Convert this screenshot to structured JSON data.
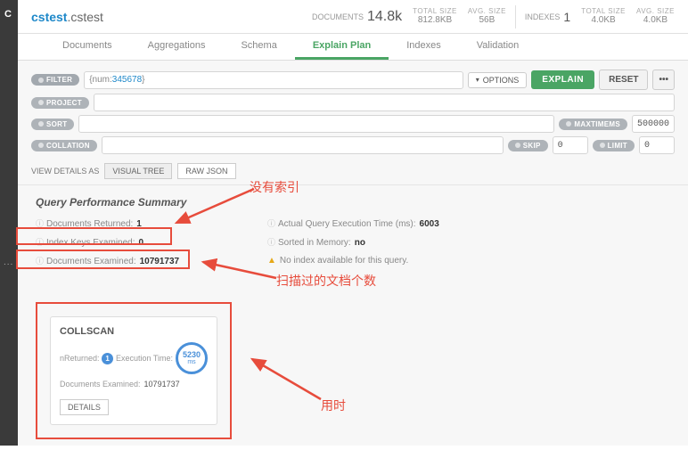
{
  "sidebar": {
    "glyph": "C",
    "dots": "..."
  },
  "header": {
    "namespace_db": "cstest",
    "namespace_coll": ".cstest",
    "documents_label": "DOCUMENTS",
    "documents_count": "14.8k",
    "total_size_label": "TOTAL SIZE",
    "total_size": "812.8KB",
    "avg_size_label": "AVG. SIZE",
    "avg_size": "56B",
    "indexes_label": "INDEXES",
    "indexes_count": "1",
    "idx_total_size_label": "TOTAL SIZE",
    "idx_total_size": "4.0KB",
    "idx_avg_size_label": "AVG. SIZE",
    "idx_avg_size": "4.0KB"
  },
  "tabs": {
    "documents": "Documents",
    "aggregations": "Aggregations",
    "schema": "Schema",
    "explain_plan": "Explain Plan",
    "indexes": "Indexes",
    "validation": "Validation"
  },
  "query": {
    "filter_label": "FILTER",
    "filter_text_prefix": "{num:",
    "filter_text_val": " 345678",
    "filter_text_suffix": "}",
    "project_label": "PROJECT",
    "sort_label": "SORT",
    "collation_label": "COLLATION",
    "skip_label": "SKIP",
    "skip_val": "0",
    "limit_label": "LIMIT",
    "limit_val": "0",
    "maxtimems_label": "MAXTIMEMS",
    "maxtimems_val": "500000",
    "options": "OPTIONS",
    "explain_btn": "EXPLAIN",
    "reset_btn": "RESET",
    "more": "•••"
  },
  "viewas": {
    "label": "VIEW DETAILS AS",
    "visual_tree": "VISUAL TREE",
    "raw_json": "RAW JSON"
  },
  "summary": {
    "title": "Query Performance Summary",
    "docs_returned_label": "Documents Returned:",
    "docs_returned": "1",
    "index_keys_label": "Index Keys Examined:",
    "index_keys": "0",
    "docs_examined_label": "Documents Examined:",
    "docs_examined": "10791737",
    "exec_time_label": "Actual Query Execution Time (ms):",
    "exec_time": "6003",
    "sorted_mem_label": "Sorted in Memory:",
    "sorted_mem": "no",
    "no_index_warn": "No index available for this query."
  },
  "annotations": {
    "no_index": "没有索引",
    "docs_scanned": "扫描过的文档个数",
    "time_used": "用时"
  },
  "stage": {
    "name": "COLLSCAN",
    "nreturned_label": "nReturned:",
    "nreturned": "1",
    "exec_time_label": "Execution Time:",
    "exec_time_val": "5230",
    "exec_time_unit": "ms",
    "docs_examined_label": "Documents Examined:",
    "docs_examined": "10791737",
    "details_btn": "DETAILS"
  }
}
